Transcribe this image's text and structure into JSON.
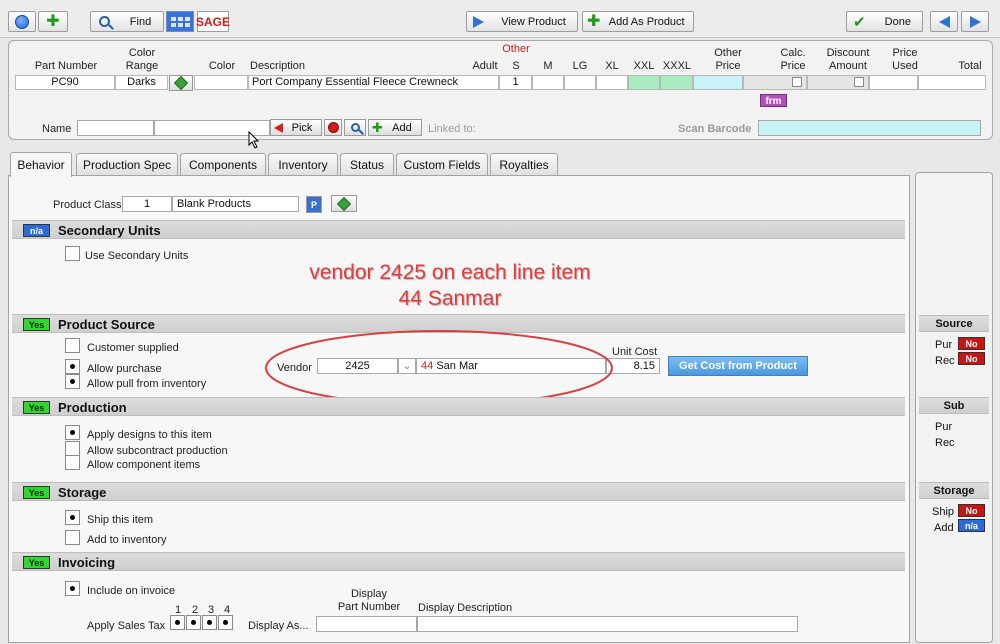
{
  "toolbar": {
    "find_label": "Find",
    "sage_label": "SAGE",
    "view_product_label": "View Product",
    "add_as_product_label": "Add As Product",
    "done_label": "Done"
  },
  "line_item": {
    "headers": {
      "part_number": "Part Number",
      "color_range": "Color\nRange",
      "color": "Color",
      "description": "Description",
      "adult": "Adult",
      "other": "Other",
      "s": "S",
      "m": "M",
      "lg": "LG",
      "xl": "XL",
      "xxl": "XXL",
      "xxxl": "XXXL",
      "other_price": "Other\nPrice",
      "calc_price": "Calc.\nPrice",
      "discount_amount": "Discount\nAmount",
      "price_used": "Price\nUsed",
      "total": "Total"
    },
    "values": {
      "part_number": "PC90",
      "color_range": "Darks",
      "color": "",
      "description": "Port  Company Essential Fleece Crewneck",
      "s": "1"
    },
    "frm_label": "frm",
    "name_label": "Name",
    "pick_label": "Pick",
    "add_label": "Add",
    "linked_to_label": "Linked to:",
    "scan_barcode_label": "Scan Barcode"
  },
  "tabs": [
    {
      "label": "Behavior"
    },
    {
      "label": "Production Spec"
    },
    {
      "label": "Components"
    },
    {
      "label": "Inventory"
    },
    {
      "label": "Status"
    },
    {
      "label": "Custom Fields"
    },
    {
      "label": "Royalties"
    }
  ],
  "behavior": {
    "product_class_label": "Product Class",
    "product_class_value": "1",
    "product_class_name": "Blank Products",
    "p_button": "P",
    "secondary_units": {
      "badge": "n/a",
      "title": "Secondary Units",
      "use_label": "Use Secondary Units"
    },
    "product_source": {
      "badge": "Yes",
      "title": "Product Source",
      "customer_supplied": "Customer supplied",
      "allow_purchase": "Allow purchase",
      "allow_pull": "Allow pull from inventory",
      "vendor_label": "Vendor",
      "vendor_number": "2425",
      "vendor_code": "44",
      "vendor_name": "San Mar",
      "unit_cost_label": "Unit Cost",
      "unit_cost_value": "8.15",
      "get_cost_label": "Get Cost from Product"
    },
    "production": {
      "badge": "Yes",
      "title": "Production",
      "apply_designs": "Apply designs to this item",
      "allow_subcontract": "Allow subcontract production",
      "allow_component": "Allow component items"
    },
    "storage": {
      "badge": "Yes",
      "title": "Storage",
      "ship_item": "Ship this item",
      "add_inventory": "Add to inventory"
    },
    "invoicing": {
      "badge": "Yes",
      "title": "Invoicing",
      "include_invoice": "Include on invoice",
      "apply_sales_tax": "Apply Sales Tax",
      "tax_nums": [
        "1",
        "2",
        "3",
        "4"
      ],
      "display_as": "Display As...",
      "display_part_number": "Display\nPart Number",
      "display_description": "Display Description"
    }
  },
  "annotation": {
    "line1": "vendor 2425 on each line item",
    "line2": "44 Sanmar"
  },
  "side": {
    "source_title": "Source",
    "sub_title": "Sub",
    "storage_title": "Storage",
    "pur": "Pur",
    "rec": "Rec",
    "ship": "Ship",
    "add": "Add",
    "no": "No",
    "na": "n/a"
  },
  "colors": {
    "accent_blue": "#2b74d8",
    "yes_green": "#2fd82f",
    "no_red": "#c81414",
    "annotation_red": "#e63a3a",
    "scan_field": "#c8f4f8"
  }
}
